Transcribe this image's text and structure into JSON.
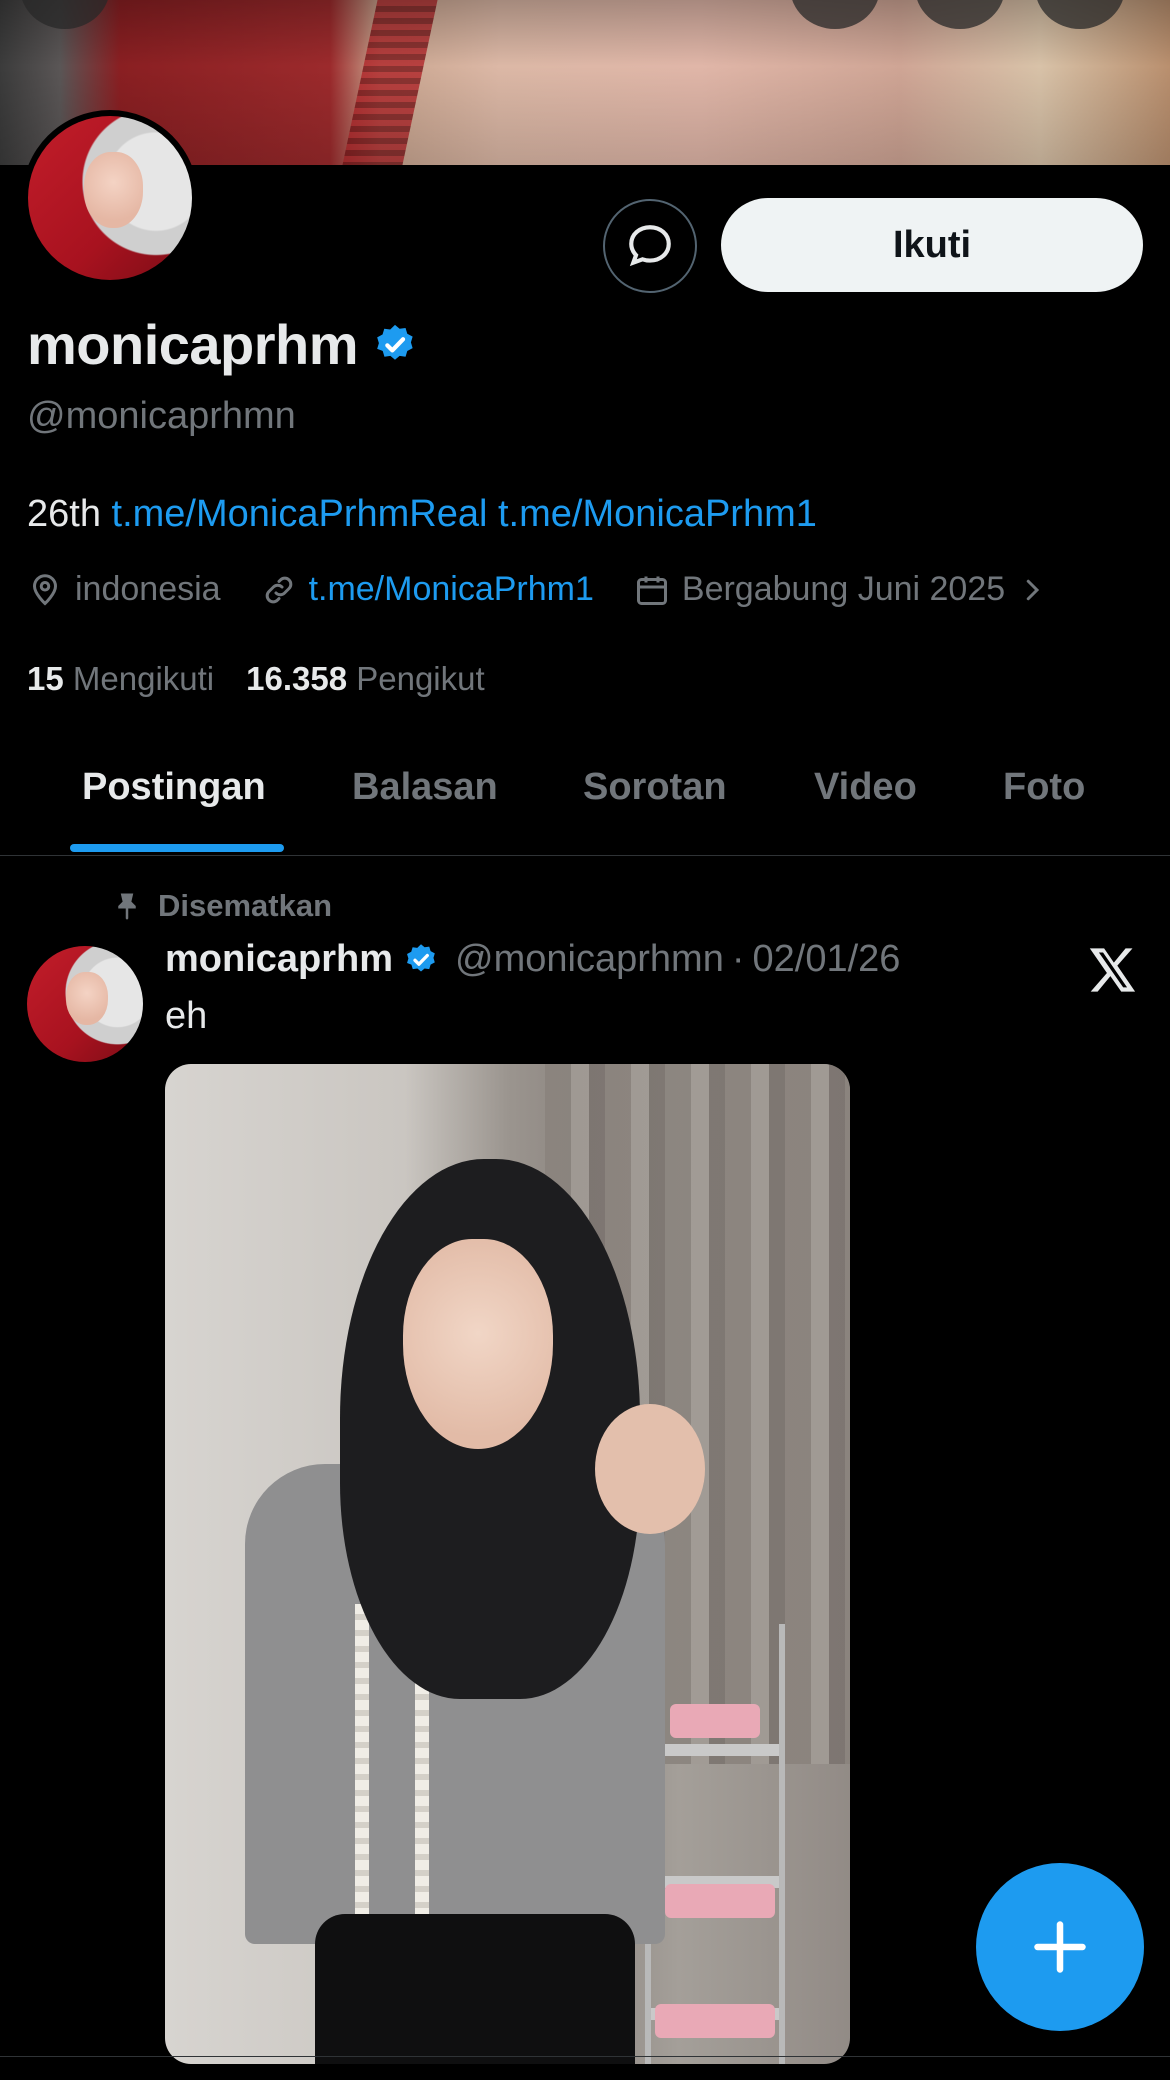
{
  "profile": {
    "display_name": "monicaprhm",
    "handle": "@monicaprhmn",
    "bio_prefix": "26th",
    "bio_links": [
      "t.me/MonicaPrhmReal",
      "t.me/MonicaPrhm1"
    ],
    "location": "indonesia",
    "website": "t.me/MonicaPrhm1",
    "joined": "Bergabung Juni 2025",
    "following_count": "15",
    "following_label": "Mengikuti",
    "followers_count": "16.358",
    "followers_label": "Pengikut",
    "verified": true
  },
  "actions": {
    "follow_label": "Ikuti"
  },
  "tabs": [
    {
      "label": "Postingan",
      "active": true
    },
    {
      "label": "Balasan",
      "active": false
    },
    {
      "label": "Sorotan",
      "active": false
    },
    {
      "label": "Video",
      "active": false
    },
    {
      "label": "Foto",
      "active": false
    }
  ],
  "pinned_post": {
    "pinned_label": "Disematkan",
    "author_name": "monicaprhm",
    "author_handle": "@monicaprhmn",
    "separator": "·",
    "date": "02/01/26",
    "text": "eh"
  },
  "colors": {
    "background": "#000000",
    "accent": "#1d9bf0",
    "text_primary": "#e7e9ea",
    "text_secondary": "#71767b",
    "follow_button": "#eff3f4"
  },
  "icons": {
    "message": "chat-bubble-icon",
    "verified": "verified-badge-icon",
    "location": "location-pin-icon",
    "link": "link-icon",
    "calendar": "calendar-icon",
    "chevron": "chevron-right-icon",
    "pin": "pin-icon",
    "x_logo": "x-logo-icon",
    "compose": "plus-icon"
  }
}
